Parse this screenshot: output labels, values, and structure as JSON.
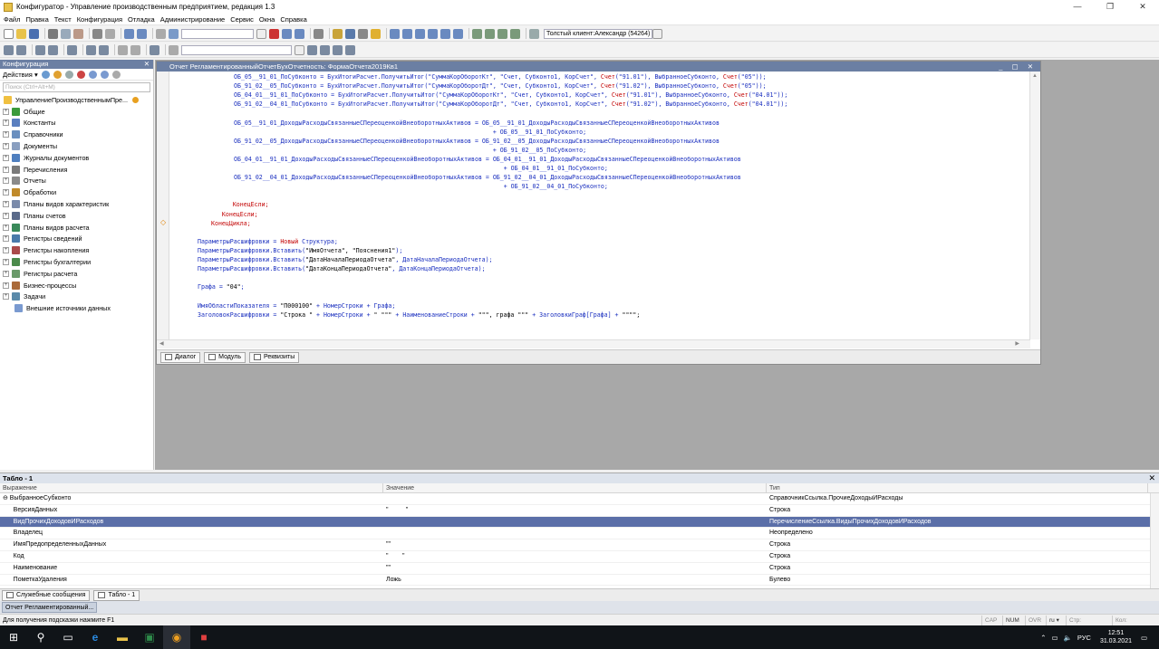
{
  "window": {
    "title": "Конфигуратор - Управление производственным предприятием, редакция 1.3",
    "controls": [
      "—",
      "❐",
      "✕"
    ]
  },
  "menu": [
    "Файл",
    "Правка",
    "Текст",
    "Конфигурация",
    "Отладка",
    "Администрирование",
    "Сервис",
    "Окна",
    "Справка"
  ],
  "toolbar": {
    "user_combo": "Толстый клиент:Александр (54264)"
  },
  "left_panel": {
    "title": "Конфигурация",
    "actions_label": "Действия ▾",
    "search_placeholder": "Поиск (Ctrl+Alt+M)",
    "root": "УправлениеПроизводственнымПре...",
    "items": [
      {
        "label": "Общие",
        "color": "#3a9a3a"
      },
      {
        "label": "Константы",
        "color": "#5a7fbf"
      },
      {
        "label": "Справочники",
        "color": "#6a8fbf"
      },
      {
        "label": "Документы",
        "color": "#8a9fc0"
      },
      {
        "label": "Журналы документов",
        "color": "#4f7fbf"
      },
      {
        "label": "Перечисления",
        "color": "#7a7a7a"
      },
      {
        "label": "Отчеты",
        "color": "#8a8a8a"
      },
      {
        "label": "Обработки",
        "color": "#c08a2a"
      },
      {
        "label": "Планы видов характеристик",
        "color": "#7a8aaa"
      },
      {
        "label": "Планы счетов",
        "color": "#5a6a8a"
      },
      {
        "label": "Планы видов расчета",
        "color": "#3a8a5a"
      },
      {
        "label": "Регистры сведений",
        "color": "#4a7aaa"
      },
      {
        "label": "Регистры накопления",
        "color": "#aa4a4a"
      },
      {
        "label": "Регистры бухгалтерии",
        "color": "#4a8a4a"
      },
      {
        "label": "Регистры расчета",
        "color": "#6a9a6a"
      },
      {
        "label": "Бизнес-процессы",
        "color": "#aa6a3a"
      },
      {
        "label": "Задачи",
        "color": "#5a8aaa"
      }
    ],
    "extra": "Внешние источники данных"
  },
  "editor": {
    "title": "Отчет РегламентированныйОтчетБухОтчетность: ФормаОтчета2019Кв1",
    "win_controls": "_ ▢ ✕",
    "lines": [
      [
        {
          "t": "ОБ_05__91_01_ПоСубконто = БухИтогиРасчет.ПолучитьИтог(\"СуммаКорОборотКт\", \"Счет, Субконто1, КорСчет\", ",
          "c": "blue"
        },
        {
          "t": "Счет",
          "c": "red"
        },
        {
          "t": "(\"91.01\"), ВыбранноеСубконто, ",
          "c": "blue"
        },
        {
          "t": "Счет",
          "c": "red"
        },
        {
          "t": "(\"05\"));",
          "c": "blue"
        }
      ],
      [
        {
          "t": "ОБ_91_02__05_ПоСубконто = БухИтогиРасчет.ПолучитьИтог(\"СуммаКорОборотДт\", \"Счет, Субконто1, КорСчет\", ",
          "c": "blue"
        },
        {
          "t": "Счет",
          "c": "red"
        },
        {
          "t": "(\"91.02\"), ВыбранноеСубконто, ",
          "c": "blue"
        },
        {
          "t": "Счет",
          "c": "red"
        },
        {
          "t": "(\"05\"));",
          "c": "blue"
        }
      ],
      [
        {
          "t": "ОБ_04_01__91_01_ПоСубконто = БухИтогиРасчет.ПолучитьИтог(\"СуммаКорОборотКт\", \"Счет, Субконто1, КорСчет\", ",
          "c": "blue"
        },
        {
          "t": "Счет",
          "c": "red"
        },
        {
          "t": "(\"91.01\"), ВыбранноеСубконто, ",
          "c": "blue"
        },
        {
          "t": "Счет",
          "c": "red"
        },
        {
          "t": "(\"04.01\"));",
          "c": "blue"
        }
      ],
      [
        {
          "t": "ОБ_91_02__04_01_ПоСубконто = БухИтогиРасчет.ПолучитьИтог(\"СуммаКорОборотДт\", \"Счет, Субконто1, КорСчет\", ",
          "c": "blue"
        },
        {
          "t": "Счет",
          "c": "red"
        },
        {
          "t": "(\"91.02\"), ВыбранноеСубконто, ",
          "c": "blue"
        },
        {
          "t": "Счет",
          "c": "red"
        },
        {
          "t": "(\"04.01\"));",
          "c": "blue"
        }
      ],
      [],
      [
        {
          "t": "ОБ_05__91_01_ДоходыРасходыСвязанныеСПереоценкойВнеоборотныхАктивов = ОБ_05__91_01_ДоходыРасходыСвязанныеСПереоценкойВнеоборотныхАктивов",
          "c": "blue"
        }
      ],
      [
        {
          "t": "                                                                        + ОБ_05__91_01_ПоСубконто;",
          "c": "blue"
        }
      ],
      [
        {
          "t": "ОБ_91_02__05_ДоходыРасходыСвязанныеСПереоценкойВнеоборотныхАктивов = ОБ_91_02__05_ДоходыРасходыСвязанныеСПереоценкойВнеоборотныхАктивов",
          "c": "blue"
        }
      ],
      [
        {
          "t": "                                                                        + ОБ_91_02__05_ПоСубконто;",
          "c": "blue"
        }
      ],
      [
        {
          "t": "ОБ_04_01__91_01_ДоходыРасходыСвязанныеСПереоценкойВнеоборотныхАктивов = ОБ_04_01__91_01_ДоходыРасходыСвязанныеСПереоценкойВнеоборотныхАктивов",
          "c": "blue"
        }
      ],
      [
        {
          "t": "                                                                           + ОБ_04_01__91_01_ПоСубконто;",
          "c": "blue"
        }
      ],
      [
        {
          "t": "ОБ_91_02__04_01_ДоходыРасходыСвязанныеСПереоценкойВнеоборотныхАктивов = ОБ_91_02__04_01_ДоходыРасходыСвязанныеСПереоценкойВнеоборотныхАктивов",
          "c": "blue"
        }
      ],
      [
        {
          "t": "                                                                           + ОБ_91_02__04_01_ПоСубконто;",
          "c": "blue"
        }
      ],
      [],
      [
        {
          "t": "      ",
          "c": "dark"
        },
        {
          "t": "КонецЕсли;",
          "c": "red"
        }
      ],
      [
        {
          "t": "   ",
          "c": "dark"
        },
        {
          "t": "КонецЕсли;",
          "c": "red"
        }
      ],
      [
        {
          "t": "КонецЦикла;",
          "c": "red"
        }
      ],
      [],
      [
        {
          "t": "ПараметрыРасшифровки = ",
          "c": "blue"
        },
        {
          "t": "Новый",
          "c": "red"
        },
        {
          "t": " Структура;",
          "c": "blue"
        }
      ],
      [
        {
          "t": "ПараметрыРасшифровки.Вставить(",
          "c": "blue"
        },
        {
          "t": "\"ИмяОтчета\", \"Пояснения1\"",
          "c": "dark"
        },
        {
          "t": ");",
          "c": "blue"
        }
      ],
      [
        {
          "t": "ПараметрыРасшифровки.Вставить(",
          "c": "blue"
        },
        {
          "t": "\"ДатаНачалаПериодаОтчета\"",
          "c": "dark"
        },
        {
          "t": ", ДатаНачалаПериодаОтчета);",
          "c": "blue"
        }
      ],
      [
        {
          "t": "ПараметрыРасшифровки.Вставить(",
          "c": "blue"
        },
        {
          "t": "\"ДатаКонцаПериодаОтчета\"",
          "c": "dark"
        },
        {
          "t": ", ДатаКонцаПериодаОтчета);",
          "c": "blue"
        }
      ],
      [],
      [
        {
          "t": "Графа = ",
          "c": "blue"
        },
        {
          "t": "\"04\"",
          "c": "dark"
        },
        {
          "t": ";",
          "c": "blue"
        }
      ],
      [],
      [
        {
          "t": "ИмяОбластиПоказателя = ",
          "c": "blue"
        },
        {
          "t": "\"П000100\"",
          "c": "dark"
        },
        {
          "t": " + НомерСтроки + Графа;",
          "c": "blue"
        }
      ],
      [
        {
          "t": "ЗаголовокРасшифровки = ",
          "c": "blue"
        },
        {
          "t": "\"Строка \"",
          "c": "dark"
        },
        {
          "t": " + НомерСтроки + ",
          "c": "blue"
        },
        {
          "t": "\" \"\"\"",
          "c": "dark"
        },
        {
          "t": " + НаименованиеСтроки + ",
          "c": "blue"
        },
        {
          "t": "\"\"\", графа \"\"\"",
          "c": "dark"
        },
        {
          "t": " + ЗаголовкиГраф[Графа] + ",
          "c": "blue"
        },
        {
          "t": "\"\"\"\";",
          "c": "dark"
        }
      ]
    ],
    "tabs": [
      "Диалог",
      "Модуль",
      "Реквизиты"
    ]
  },
  "table": {
    "title": "Табло - 1",
    "columns": [
      "Выражение",
      "Значение",
      "Тип"
    ],
    "rows": [
      {
        "expr": "⊖ ВыбранноеСубконто",
        "value": "",
        "type": "СправочникСсылка.ПрочиеДоходыИРасходы",
        "selected": false
      },
      {
        "expr": "      ВерсияДанных",
        "value": "\"          \"",
        "type": "Строка",
        "selected": false
      },
      {
        "expr": "      ВидПрочихДоходовИРасходов",
        "value": "",
        "type": "ПеречислениеСсылка.ВидыПрочихДоходовИРасходов",
        "selected": true
      },
      {
        "expr": "      Владелец",
        "value": "",
        "type": "Неопределено",
        "selected": false
      },
      {
        "expr": "      ИмяПредопределенныхДанных",
        "value": "\"\"",
        "type": "Строка",
        "selected": false
      },
      {
        "expr": "      Код",
        "value": "\"        \"",
        "type": "Строка",
        "selected": false
      },
      {
        "expr": "      Наименование",
        "value": "\"\"",
        "type": "Строка",
        "selected": false
      },
      {
        "expr": "      ПометкаУдаления",
        "value": "Ложь",
        "type": "Булево",
        "selected": false
      }
    ]
  },
  "bottom_tabs": [
    "Служебные сообщения",
    "Табло - 1"
  ],
  "window_list": [
    "Отчет Регламентированный..."
  ],
  "status": {
    "hint": "Для получения подсказки нажмите F1",
    "indicators": [
      "CAP",
      "NUM",
      "OVR",
      "ru ▾",
      "Стр:",
      "Кол:"
    ]
  },
  "taskbar": {
    "lang": "РУС",
    "time": "12:51",
    "date": "31.03.2021"
  }
}
